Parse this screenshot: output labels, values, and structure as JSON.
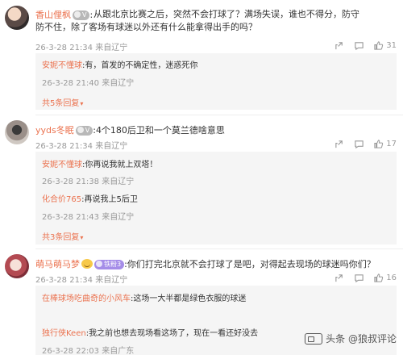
{
  "comments": [
    {
      "user": "香山俚枫",
      "badge_text": "",
      "separator": ":",
      "text": "从跟北京比赛之后，突然不会打球了？满场失误，谁也不得分，防守防不住，除了客场有球迷以外还有什么能拿得出手的吗？",
      "time": "26-3-28 21:34 来自辽宁",
      "like_count": "31",
      "replies": [
        {
          "user": "安妮不懂球",
          "text": "有，首发的不确定性，迷惑死你",
          "time": "26-3-28 21:40 来自辽宁"
        }
      ],
      "more_label": "共5条回复"
    },
    {
      "user": "yyds冬眠",
      "badge_text": "",
      "separator": ":",
      "text": "4个180后卫和一个莫兰德啥意思",
      "time": "26-3-28 21:34 来自辽宁",
      "like_count": "17",
      "replies": [
        {
          "user": "安妮不懂球",
          "text": "你再说我就上双塔！",
          "time": "26-3-28 21:38 来自辽宁"
        },
        {
          "user": "化合价765",
          "text": "再说我上5后卫",
          "time": "26-3-28 21:43 来自辽宁"
        }
      ],
      "more_label": "共3条回复"
    },
    {
      "user": "萌马萌马梦",
      "badge_text": "铁粉3",
      "separator": ":",
      "text": "你们打完北京就不会打球了是吧，对得起去现场的球迷吗你们？",
      "time": "26-3-28 21:34 来自辽宁",
      "like_count": "16",
      "replies": [
        {
          "user": "在棒球场吃曲奇的小风车",
          "text": "这场一大半都是绿色衣服的球迷",
          "time": ""
        },
        {
          "user": "独行侠Keen",
          "text": "我之前也想去现场看这场了，现在一看还好没去",
          "time": "26-3-28 22:03 来自广东"
        }
      ],
      "more_label": ""
    }
  ],
  "watermark": {
    "text": "头条 @狼叔评论",
    "icon": "toutiao-logo-icon"
  },
  "icons": [
    "share-icon",
    "comment-icon",
    "like-icon"
  ],
  "colors": {
    "username": "#eb7350",
    "meta": "#999999",
    "reply_bg": "#f5f5f5",
    "badge": "#a58de8"
  }
}
